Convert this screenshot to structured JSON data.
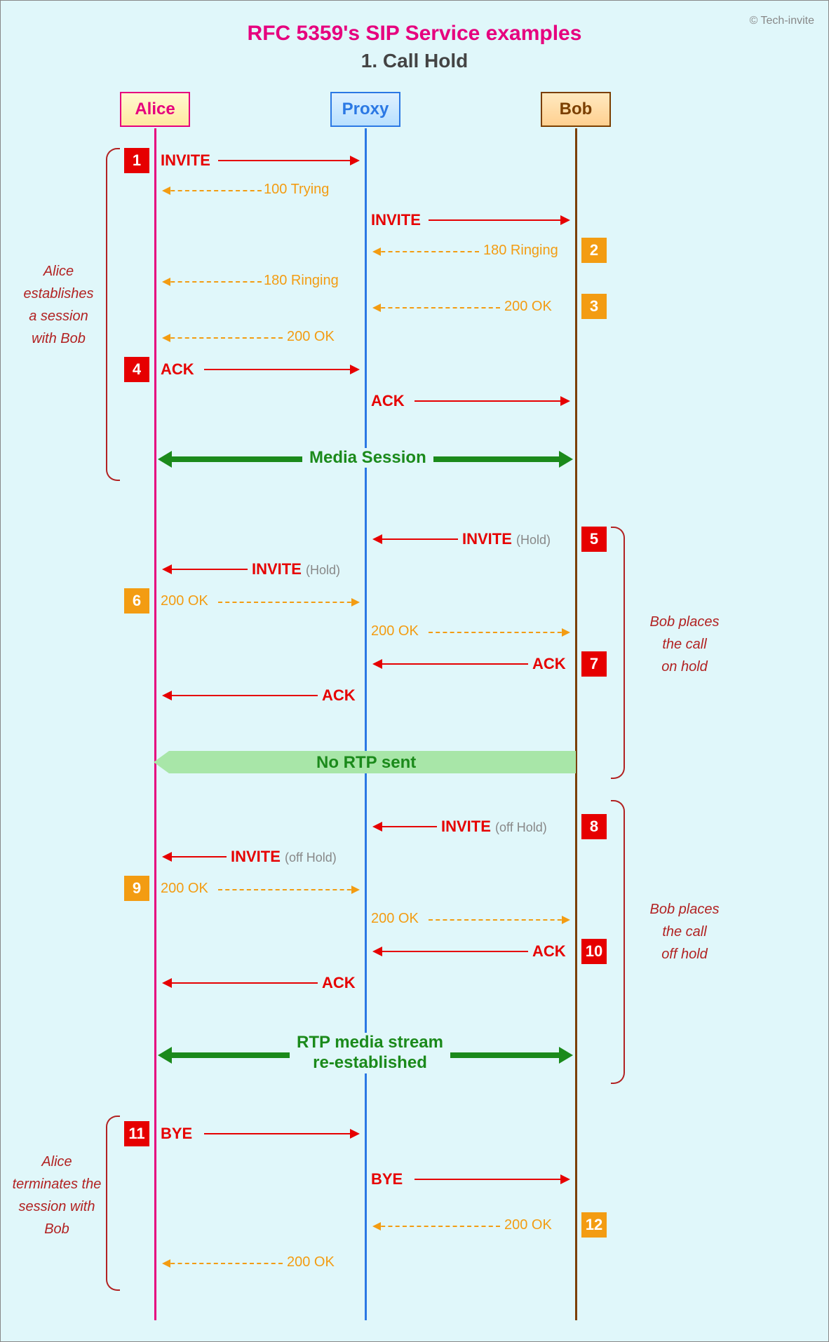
{
  "copyright": "© Tech-invite",
  "title_line1": "RFC 5359's SIP Service examples",
  "title_line2": "1. Call Hold",
  "participants": {
    "alice": "Alice",
    "proxy": "Proxy",
    "bob": "Bob"
  },
  "phases": {
    "p1": "Alice\nestablishes\na session\nwith Bob",
    "p2": "Bob places\nthe call\non hold",
    "p3": "Bob places\nthe call\noff hold",
    "p4": "Alice\nterminates the\nsession with\nBob"
  },
  "media": {
    "session": "Media Session",
    "nortp": "No RTP sent",
    "reest": "RTP media stream\nre-established"
  },
  "messages": {
    "m1": {
      "num": "1",
      "label": "INVITE"
    },
    "m1r": "100 Trying",
    "m2f": "INVITE",
    "m2": {
      "num": "2",
      "label": "180 Ringing"
    },
    "m2r": "180 Ringing",
    "m3": {
      "num": "3",
      "label": "200 OK"
    },
    "m3r": "200 OK",
    "m4": {
      "num": "4",
      "label": "ACK"
    },
    "m4f": "ACK",
    "m5": {
      "num": "5",
      "label": "INVITE",
      "sub": "(Hold)"
    },
    "m5f": {
      "label": "INVITE",
      "sub": "(Hold)"
    },
    "m6": {
      "num": "6",
      "label": "200 OK"
    },
    "m6f": "200 OK",
    "m7": {
      "num": "7",
      "label": "ACK"
    },
    "m7f": "ACK",
    "m8": {
      "num": "8",
      "label": "INVITE",
      "sub": "(off Hold)"
    },
    "m8f": {
      "label": "INVITE",
      "sub": "(off Hold)"
    },
    "m9": {
      "num": "9",
      "label": "200 OK"
    },
    "m9f": "200 OK",
    "m10": {
      "num": "10",
      "label": "ACK"
    },
    "m10f": "ACK",
    "m11": {
      "num": "11",
      "label": "BYE"
    },
    "m11f": "BYE",
    "m12": {
      "num": "12",
      "label": "200 OK"
    },
    "m12f": "200 OK"
  }
}
